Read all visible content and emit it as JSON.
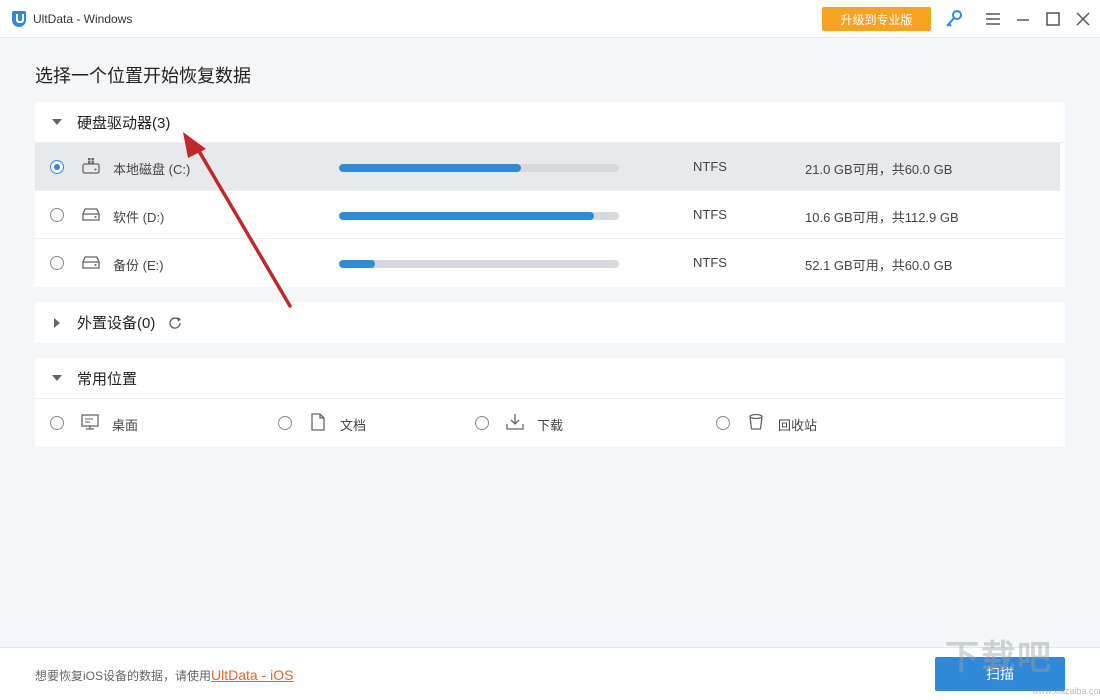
{
  "window": {
    "title": "UltData - Windows",
    "upgrade_label": "升级到专业版"
  },
  "heading": "选择一个位置开始恢复数据",
  "hard_drives": {
    "header": "硬盘驱动器(3)",
    "drives": [
      {
        "name": "本地磁盘 (C:)",
        "usage_fraction": 0.65,
        "fs": "NTFS",
        "space": "21.0 GB可用，共60.0 GB",
        "selected": true
      },
      {
        "name": "软件 (D:)",
        "usage_fraction": 0.91,
        "fs": "NTFS",
        "space": "10.6 GB可用，共112.9 GB",
        "selected": false
      },
      {
        "name": "备份 (E:)",
        "usage_fraction": 0.13,
        "fs": "NTFS",
        "space": "52.1 GB可用，共60.0 GB",
        "selected": false
      }
    ]
  },
  "external": {
    "header": "外置设备(0)"
  },
  "common": {
    "header": "常用位置",
    "locations": [
      {
        "label": "桌面",
        "icon": "desktop-icon"
      },
      {
        "label": "文档",
        "icon": "document-icon"
      },
      {
        "label": "下载",
        "icon": "download-icon"
      },
      {
        "label": "回收站",
        "icon": "recycle-bin-icon"
      }
    ]
  },
  "footer": {
    "text": "想要恢复iOS设备的数据，请使用",
    "link": "UltData - iOS",
    "scan_label": "扫描"
  },
  "watermark": {
    "text": "下载吧",
    "sub": "www.xiazaiba.com"
  },
  "colors": {
    "accent": "#2f88d8",
    "upgrade": "#f8a224",
    "link": "#e2682b",
    "annotation_arrow": "#c0282a"
  }
}
